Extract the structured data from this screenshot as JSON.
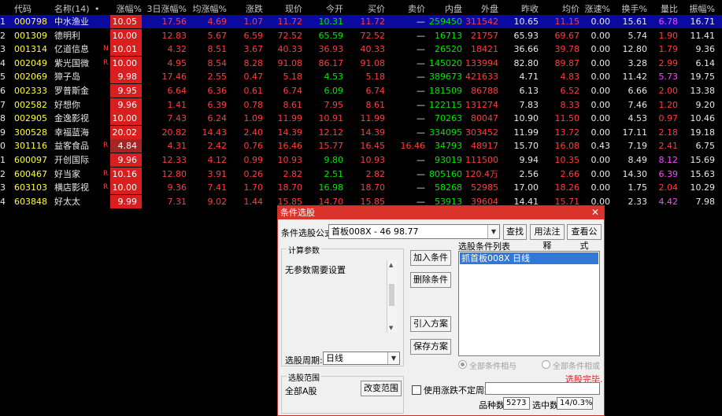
{
  "columns": {
    "idx": "",
    "code": "代码",
    "name": "名称(14)",
    "dot": "•",
    "chg_pct": "涨幅%",
    "chg3d": "3日涨幅%",
    "avg_chg": "均涨幅%",
    "change": "涨跌",
    "price": "现价",
    "open": "今开",
    "bid": "买价",
    "ask": "卖价",
    "inner": "内盘",
    "outer": "外盘",
    "prev_close": "昨收",
    "avg_price": "均价",
    "speed": "涨速%",
    "turnover": "换手%",
    "vol_ratio": "量比",
    "amplitude": "振幅%"
  },
  "rows": [
    {
      "idx": "1",
      "code": "000798",
      "name": "中水渔业",
      "flag": "",
      "chg_pct": "10.05",
      "chg3d": "17.56",
      "avg_chg": "4.69",
      "change": "1.07",
      "price": "11.72",
      "open": "10.31",
      "bid": "11.72",
      "ask": "—",
      "inner": "259450",
      "outer": "311542",
      "prev_close": "10.65",
      "avg_price": "11.15",
      "speed": "0.00",
      "turnover": "15.61",
      "vol_ratio": "6.78",
      "amplitude": "16.71"
    },
    {
      "idx": "2",
      "code": "001309",
      "name": "德明利",
      "flag": "",
      "chg_pct": "10.00",
      "chg3d": "12.83",
      "avg_chg": "5.67",
      "change": "6.59",
      "price": "72.52",
      "open": "65.59",
      "bid": "72.52",
      "ask": "—",
      "inner": "16713",
      "outer": "21757",
      "prev_close": "65.93",
      "avg_price": "69.67",
      "speed": "0.00",
      "turnover": "5.74",
      "vol_ratio": "1.90",
      "amplitude": "11.41"
    },
    {
      "idx": "3",
      "code": "001314",
      "name": "亿道信息",
      "flag": "N",
      "chg_pct": "10.01",
      "chg3d": "4.32",
      "avg_chg": "8.51",
      "change": "3.67",
      "price": "40.33",
      "open": "36.93",
      "bid": "40.33",
      "ask": "—",
      "inner": "26520",
      "outer": "18421",
      "prev_close": "36.66",
      "avg_price": "39.78",
      "speed": "0.00",
      "turnover": "12.80",
      "vol_ratio": "1.79",
      "amplitude": "9.36"
    },
    {
      "idx": "4",
      "code": "002049",
      "name": "紫光国微",
      "flag": "R",
      "chg_pct": "10.00",
      "chg3d": "4.95",
      "avg_chg": "8.54",
      "change": "8.28",
      "price": "91.08",
      "open": "86.17",
      "bid": "91.08",
      "ask": "—",
      "inner": "145020",
      "outer": "133994",
      "prev_close": "82.80",
      "avg_price": "89.87",
      "speed": "0.00",
      "turnover": "3.28",
      "vol_ratio": "2.99",
      "amplitude": "6.14"
    },
    {
      "idx": "5",
      "code": "002069",
      "name": "獐子岛",
      "flag": "",
      "chg_pct": "9.98",
      "chg3d": "17.46",
      "avg_chg": "2.55",
      "change": "0.47",
      "price": "5.18",
      "open": "4.53",
      "bid": "5.18",
      "ask": "—",
      "inner": "389673",
      "outer": "421633",
      "prev_close": "4.71",
      "avg_price": "4.83",
      "speed": "0.00",
      "turnover": "11.42",
      "vol_ratio": "5.73",
      "amplitude": "19.75"
    },
    {
      "idx": "6",
      "code": "002333",
      "name": "罗普斯金",
      "flag": "",
      "chg_pct": "9.95",
      "chg3d": "6.64",
      "avg_chg": "6.36",
      "change": "0.61",
      "price": "6.74",
      "open": "6.09",
      "bid": "6.74",
      "ask": "—",
      "inner": "181509",
      "outer": "86788",
      "prev_close": "6.13",
      "avg_price": "6.52",
      "speed": "0.00",
      "turnover": "6.66",
      "vol_ratio": "2.00",
      "amplitude": "13.38"
    },
    {
      "idx": "7",
      "code": "002582",
      "name": "好想你",
      "flag": "",
      "chg_pct": "9.96",
      "chg3d": "1.41",
      "avg_chg": "6.39",
      "change": "0.78",
      "price": "8.61",
      "open": "7.95",
      "bid": "8.61",
      "ask": "—",
      "inner": "122115",
      "outer": "131274",
      "prev_close": "7.83",
      "avg_price": "8.33",
      "speed": "0.00",
      "turnover": "7.46",
      "vol_ratio": "1.20",
      "amplitude": "9.20"
    },
    {
      "idx": "8",
      "code": "002905",
      "name": "金逸影视",
      "flag": "",
      "chg_pct": "10.00",
      "chg3d": "7.43",
      "avg_chg": "6.24",
      "change": "1.09",
      "price": "11.99",
      "open": "10.91",
      "bid": "11.99",
      "ask": "—",
      "inner": "70263",
      "outer": "80047",
      "prev_close": "10.90",
      "avg_price": "11.50",
      "speed": "0.00",
      "turnover": "4.53",
      "vol_ratio": "0.97",
      "amplitude": "10.46"
    },
    {
      "idx": "9",
      "code": "300528",
      "name": "幸福蓝海",
      "flag": "",
      "chg_pct": "20.02",
      "chg3d": "20.82",
      "avg_chg": "14.43",
      "change": "2.40",
      "price": "14.39",
      "open": "12.12",
      "bid": "14.39",
      "ask": "—",
      "inner": "334095",
      "outer": "303452",
      "prev_close": "11.99",
      "avg_price": "13.72",
      "speed": "0.00",
      "turnover": "17.11",
      "vol_ratio": "2.18",
      "amplitude": "19.18"
    },
    {
      "idx": "0",
      "code": "301116",
      "name": "益客食品",
      "flag": "R",
      "chg_pct": "4.84",
      "chg3d": "4.31",
      "avg_chg": "2.42",
      "change": "0.76",
      "price": "16.46",
      "open": "15.77",
      "bid": "16.45",
      "ask": "16.46",
      "inner": "34793",
      "outer": "48917",
      "prev_close": "15.70",
      "avg_price": "16.08",
      "speed": "0.43",
      "turnover": "7.19",
      "vol_ratio": "2.41",
      "amplitude": "6.75"
    },
    {
      "idx": "1",
      "code": "600097",
      "name": "开创国际",
      "flag": "",
      "chg_pct": "9.96",
      "chg3d": "12.33",
      "avg_chg": "4.12",
      "change": "0.99",
      "price": "10.93",
      "open": "9.80",
      "bid": "10.93",
      "ask": "—",
      "inner": "93019",
      "outer": "111500",
      "prev_close": "9.94",
      "avg_price": "10.35",
      "speed": "0.00",
      "turnover": "8.49",
      "vol_ratio": "8.12",
      "amplitude": "15.69"
    },
    {
      "idx": "2",
      "code": "600467",
      "name": "好当家",
      "flag": "R",
      "chg_pct": "10.16",
      "chg3d": "12.80",
      "avg_chg": "3.91",
      "change": "0.26",
      "price": "2.82",
      "open": "2.51",
      "bid": "2.82",
      "ask": "—",
      "inner": "805160",
      "outer": "120.4万",
      "prev_close": "2.56",
      "avg_price": "2.66",
      "speed": "0.00",
      "turnover": "14.30",
      "vol_ratio": "6.39",
      "amplitude": "15.63"
    },
    {
      "idx": "3",
      "code": "603103",
      "name": "横店影视",
      "flag": "R",
      "chg_pct": "10.00",
      "chg3d": "9.36",
      "avg_chg": "7.41",
      "change": "1.70",
      "price": "18.70",
      "open": "16.98",
      "bid": "18.70",
      "ask": "—",
      "inner": "58268",
      "outer": "52985",
      "prev_close": "17.00",
      "avg_price": "18.26",
      "speed": "0.00",
      "turnover": "1.75",
      "vol_ratio": "2.04",
      "amplitude": "10.29"
    },
    {
      "idx": "4",
      "code": "603848",
      "name": "好太太",
      "flag": "",
      "chg_pct": "9.99",
      "chg3d": "7.31",
      "avg_chg": "9.02",
      "change": "1.44",
      "price": "15.85",
      "open": "14.70",
      "bid": "15.85",
      "ask": "—",
      "inner": "53913",
      "outer": "39604",
      "prev_close": "14.41",
      "avg_price": "15.71",
      "speed": "0.00",
      "turnover": "2.33",
      "vol_ratio": "4.42",
      "amplitude": "7.98"
    }
  ],
  "dialog": {
    "title": "条件选股",
    "close": "✕",
    "formula_label": "条件选股公式",
    "formula_value": "首板008X  -  46  98.77",
    "btn_find": "查找",
    "btn_usage": "用法注释",
    "btn_view": "查看公式",
    "params_label": "计算参数",
    "params_text": "无参数需要设置",
    "btn_add": "加入条件",
    "btn_delete": "删除条件",
    "btn_import": "引入方案",
    "btn_save": "保存方案",
    "list_label": "选股条件列表",
    "list_items": [
      "抓首板008X  日线"
    ],
    "period_label": "选股周期:",
    "period_value": "日线",
    "radio_and": "全部条件相与",
    "radio_or": "全部条件相或",
    "status": "选股完毕.",
    "range_label": "选股范围",
    "range_value": "全部A股",
    "btn_range": "改变范围",
    "chk_indef": "使用涨跌不定周期",
    "count_label": "品种数",
    "count_value": "5273",
    "selected_label": "选中数",
    "selected_value": "14/0.3%"
  },
  "colors": {
    "up_red": "#ff3d3d",
    "down_green": "#00e600",
    "selected_bg": "#0a0aa0",
    "badge_red": "#d81e1e",
    "title_red": "#d9332b"
  }
}
